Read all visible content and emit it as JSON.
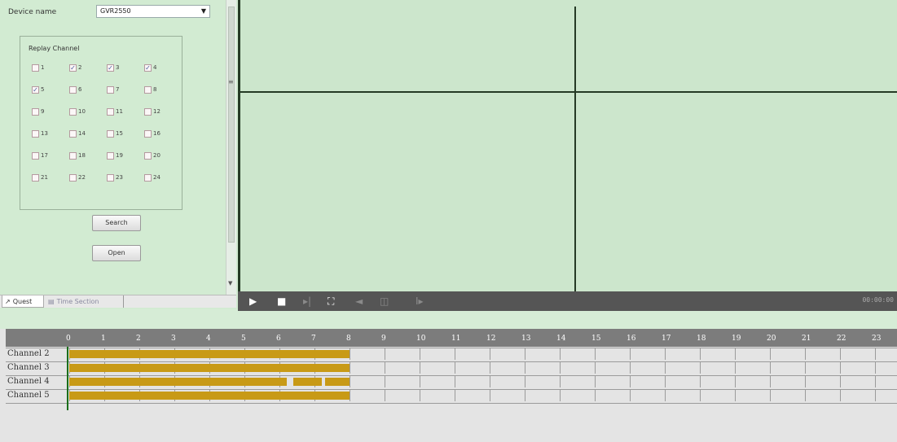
{
  "left_panel": {
    "device_label": "Device name",
    "device_value": "GVR2550",
    "group_title": "Replay Channel",
    "channels": [
      {
        "num": "1",
        "checked": false
      },
      {
        "num": "2",
        "checked": true
      },
      {
        "num": "3",
        "checked": true
      },
      {
        "num": "4",
        "checked": true
      },
      {
        "num": "5",
        "checked": true
      },
      {
        "num": "6",
        "checked": false
      },
      {
        "num": "7",
        "checked": false
      },
      {
        "num": "8",
        "checked": false
      },
      {
        "num": "9",
        "checked": false
      },
      {
        "num": "10",
        "checked": false
      },
      {
        "num": "11",
        "checked": false
      },
      {
        "num": "12",
        "checked": false
      },
      {
        "num": "13",
        "checked": false
      },
      {
        "num": "14",
        "checked": false
      },
      {
        "num": "15",
        "checked": false
      },
      {
        "num": "16",
        "checked": false
      },
      {
        "num": "17",
        "checked": false
      },
      {
        "num": "18",
        "checked": false
      },
      {
        "num": "19",
        "checked": false
      },
      {
        "num": "20",
        "checked": false
      },
      {
        "num": "21",
        "checked": false
      },
      {
        "num": "22",
        "checked": false
      },
      {
        "num": "23",
        "checked": false
      },
      {
        "num": "24",
        "checked": false
      }
    ],
    "search_label": "Search",
    "open_label": "Open",
    "tabs": [
      "Quest",
      "Time Section"
    ]
  },
  "toolbar": {
    "buttons": [
      {
        "name": "play-icon",
        "glyph": "▶",
        "enabled": true
      },
      {
        "name": "stop-icon",
        "glyph": "■",
        "enabled": true
      },
      {
        "name": "step-forward-icon",
        "glyph": "▸|",
        "enabled": false
      },
      {
        "name": "fullscreen-icon",
        "glyph": "⛶",
        "enabled": true
      },
      {
        "name": "volume-icon",
        "glyph": "◄",
        "enabled": false
      },
      {
        "name": "snapshot-icon",
        "glyph": "◫",
        "enabled": false
      },
      {
        "name": "speed-icon",
        "glyph": "I▸",
        "enabled": false
      }
    ],
    "time_readout": "00:00:00"
  },
  "timeline": {
    "hours": [
      "0",
      "1",
      "2",
      "3",
      "4",
      "5",
      "6",
      "7",
      "8",
      "9",
      "10",
      "11",
      "12",
      "13",
      "14",
      "15",
      "16",
      "17",
      "18",
      "19",
      "20",
      "21",
      "22",
      "23"
    ],
    "rows": [
      {
        "label": "Channel 2",
        "segments": [
          [
            0,
            8
          ]
        ]
      },
      {
        "label": "Channel 3",
        "segments": [
          [
            0,
            8
          ]
        ]
      },
      {
        "label": "Channel 4",
        "segments": [
          [
            0,
            6.2
          ],
          [
            6.4,
            7.2
          ],
          [
            7.3,
            8
          ]
        ]
      },
      {
        "label": "Channel 5",
        "segments": [
          [
            0,
            8
          ]
        ]
      }
    ],
    "record_color": "#c89a16",
    "marker_color": "#1a6e1a"
  }
}
